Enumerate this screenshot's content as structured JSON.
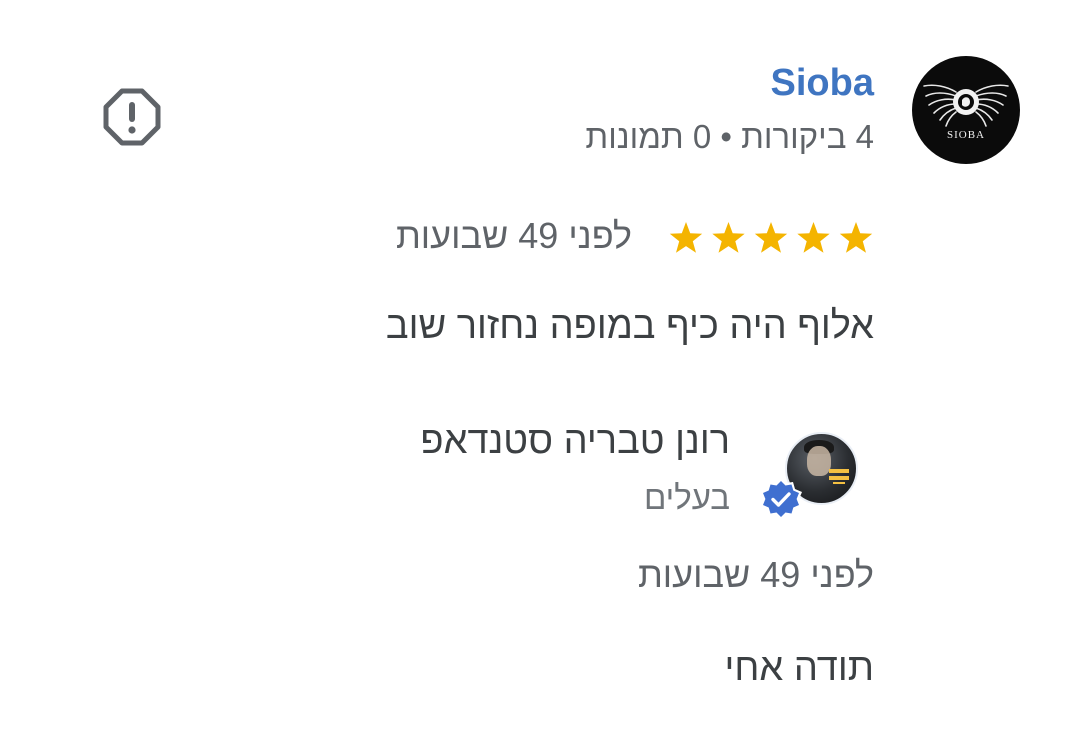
{
  "review": {
    "reviewer": {
      "name": "Sioba",
      "meta": "4 ביקורות • 0 תמונות",
      "avatar_text": "SIOBA",
      "avatar_icon": "winged-logo-icon",
      "name_color": "#3f75c1"
    },
    "report_icon": "report-alert-icon",
    "rating": 5,
    "rating_max": 5,
    "star_color": "#f4b400",
    "time": "לפני 49 שבועות",
    "text": "אלוף היה כיף במופה נחזור שוב"
  },
  "owner_response": {
    "name": "רונן טבריה סטנדאפ",
    "role": "בעלים",
    "avatar_icon": "owner-photo-avatar",
    "badge_icon": "verified-check-icon",
    "badge_color": "#3f6fd0",
    "time": "לפני 49 שבועות",
    "text": "תודה אחי"
  }
}
